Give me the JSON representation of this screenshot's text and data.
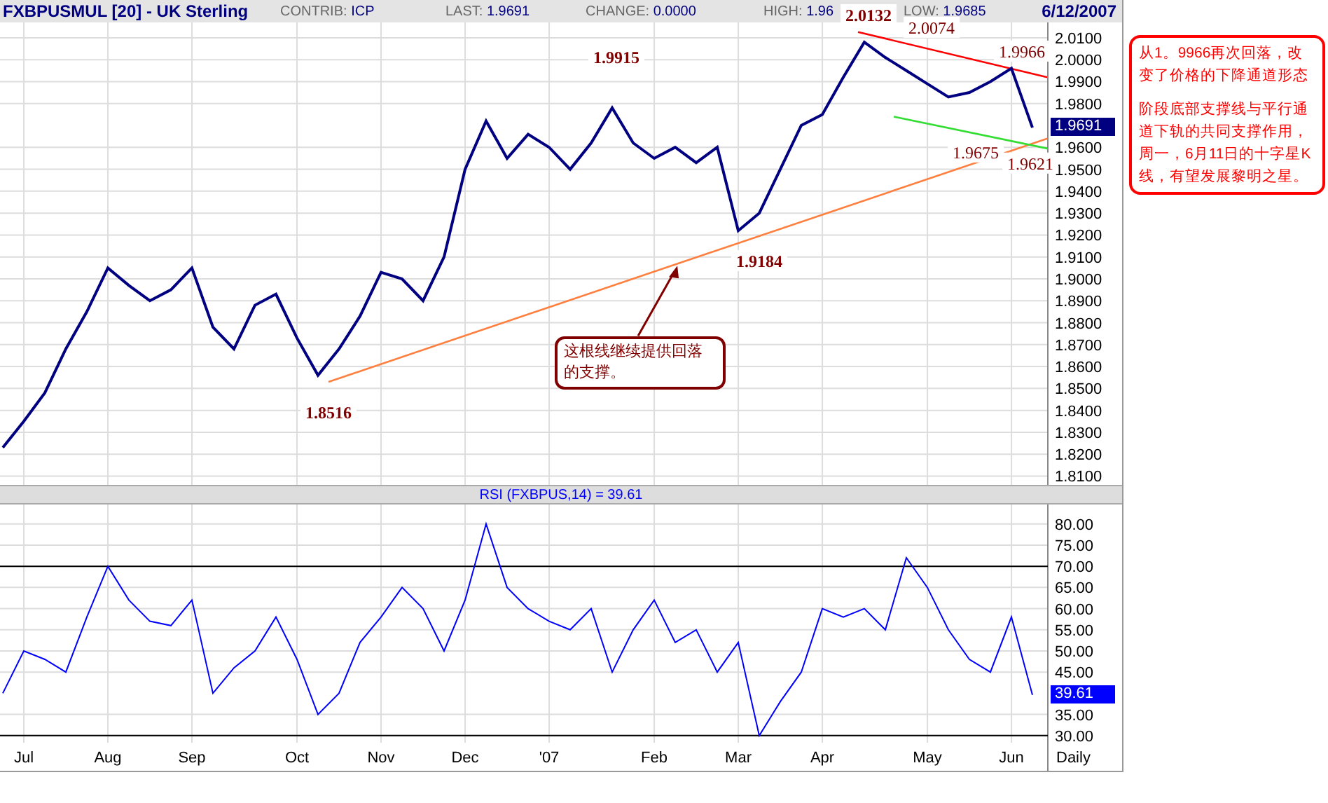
{
  "header": {
    "symbol": "FXBPUSMUL [20] - UK Sterling",
    "fields": [
      {
        "label": "CONTRIB:",
        "value": "ICP"
      },
      {
        "label": "LAST:",
        "value": "1.9691"
      },
      {
        "label": "CHANGE:",
        "value": "0.0000"
      },
      {
        "label": "HIGH:",
        "value": "1.96"
      },
      {
        "label": "LOW:",
        "value": "1.9685"
      }
    ],
    "date": "6/12/2007"
  },
  "price_panel": {
    "last_marker": "1.9691",
    "chart_data": {
      "type": "line",
      "ylim": [
        1.806,
        2.017
      ],
      "grid": true,
      "categories": [
        null,
        null,
        null,
        null,
        null,
        null,
        null,
        null,
        null,
        null,
        null,
        null,
        null,
        null,
        null,
        null,
        null,
        null,
        null,
        null,
        null,
        null,
        null,
        null,
        null,
        null,
        null,
        null,
        null,
        null,
        null,
        null,
        null,
        null,
        null,
        null,
        null,
        null,
        null,
        null,
        null,
        null,
        null,
        null,
        null,
        null,
        null,
        null,
        null,
        null
      ],
      "series": [
        {
          "color": "#000080",
          "values": [
            1.823,
            1.835,
            1.848,
            1.868,
            1.885,
            1.905,
            1.897,
            1.89,
            1.895,
            1.905,
            1.878,
            1.868,
            1.888,
            1.893,
            1.873,
            1.856,
            1.868,
            1.883,
            1.903,
            1.9,
            1.89,
            1.91,
            1.95,
            1.972,
            1.955,
            1.966,
            1.96,
            1.95,
            1.962,
            1.978,
            1.962,
            1.955,
            1.96,
            1.953,
            1.96,
            1.922,
            1.93,
            1.95,
            1.97,
            1.975,
            1.992,
            2.008,
            2.001,
            1.995,
            1.989,
            1.983,
            1.985,
            1.99,
            1.996,
            1.969
          ]
        }
      ],
      "yticks": [
        {
          "value": 1.81,
          "label": "1.8100"
        },
        {
          "value": 1.82,
          "label": "1.8200"
        },
        {
          "value": 1.83,
          "label": "1.8300"
        },
        {
          "value": 1.84,
          "label": "1.8400"
        },
        {
          "value": 1.85,
          "label": "1.8500"
        },
        {
          "value": 1.86,
          "label": "1.8600"
        },
        {
          "value": 1.87,
          "label": "1.8700"
        },
        {
          "value": 1.88,
          "label": "1.8800"
        },
        {
          "value": 1.89,
          "label": "1.8900"
        },
        {
          "value": 1.9,
          "label": "1.9000"
        },
        {
          "value": 1.91,
          "label": "1.9100"
        },
        {
          "value": 1.92,
          "label": "1.9200"
        },
        {
          "value": 1.93,
          "label": "1.9300"
        },
        {
          "value": 1.94,
          "label": "1.9400"
        },
        {
          "value": 1.95,
          "label": "1.9500"
        },
        {
          "value": 1.96,
          "label": "1.9600"
        },
        {
          "value": 1.98,
          "label": "1.9800"
        },
        {
          "value": 1.99,
          "label": "1.9900"
        },
        {
          "value": 2.0,
          "label": "2.0000"
        },
        {
          "value": 2.01,
          "label": "2.0100"
        }
      ]
    },
    "trend_lines": [
      {
        "color": "#ff7f3f"
      },
      {
        "color": "#ff0000"
      },
      {
        "color": "#33dd33"
      }
    ],
    "price_labels": [
      {
        "text": "1.8516",
        "bold": true
      },
      {
        "text": "1.9915",
        "bold": true
      },
      {
        "text": "2.0132",
        "bold": true
      },
      {
        "text": "2.0074",
        "bold": false
      },
      {
        "text": "1.9966",
        "bold": false
      },
      {
        "text": "1.9675",
        "bold": false
      },
      {
        "text": "1.9621",
        "bold": false
      },
      {
        "text": "1.9184",
        "bold": true
      }
    ],
    "callouts": [
      "这根线继续提供回落的支撑。"
    ]
  },
  "note": {
    "paragraphs": [
      "从1。9966再次回落，改变了价格的下降通道形态",
      "阶段底部支撑线与平行通道下轨的共同支撑作用，周一，6月11日的十字星K线，有望发展黎明之星。"
    ]
  },
  "rsi_panel": {
    "title": "RSI (FXBPUS,14) = 39.61",
    "last_marker": "39.61",
    "chart_data": {
      "type": "line",
      "ylim": [
        28.3,
        84.6
      ],
      "grid": true,
      "categories": [
        null,
        "Jul",
        null,
        null,
        null,
        "Aug",
        null,
        null,
        null,
        "Sep",
        null,
        null,
        null,
        null,
        "Oct",
        null,
        null,
        null,
        "Nov",
        null,
        null,
        null,
        "Dec",
        null,
        null,
        null,
        "'07",
        null,
        null,
        null,
        null,
        "Feb",
        null,
        null,
        null,
        "Mar",
        null,
        null,
        null,
        "Apr",
        null,
        null,
        null,
        null,
        "May",
        null,
        null,
        null,
        "Jun",
        null
      ],
      "series": [
        {
          "color": "#0000ff",
          "values": [
            40,
            50,
            48,
            45,
            58,
            70,
            62,
            57,
            56,
            62,
            40,
            46,
            50,
            58,
            48,
            35,
            40,
            52,
            58,
            65,
            60,
            50,
            62,
            80,
            65,
            60,
            57,
            55,
            60,
            45,
            55,
            62,
            52,
            55,
            45,
            52,
            30,
            38,
            45,
            60,
            58,
            60,
            55,
            72,
            65,
            55,
            48,
            45,
            58,
            39.6
          ]
        }
      ],
      "yticks": [
        {
          "value": 30,
          "label": "30.00"
        },
        {
          "value": 35,
          "label": "35.00"
        },
        {
          "value": 45,
          "label": "45.00"
        },
        {
          "value": 50,
          "label": "50.00"
        },
        {
          "value": 55,
          "label": "55.00"
        },
        {
          "value": 60,
          "label": "60.00"
        },
        {
          "value": 65,
          "label": "65.00"
        },
        {
          "value": 70,
          "label": "70.00"
        },
        {
          "value": 75,
          "label": "75.00"
        },
        {
          "value": 80,
          "label": "80.00"
        }
      ]
    }
  },
  "x_axis": {
    "period": "Daily"
  }
}
